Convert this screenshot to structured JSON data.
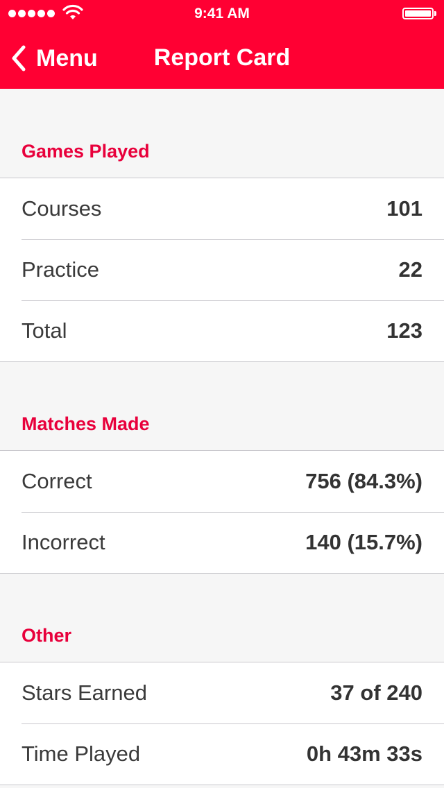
{
  "status_bar": {
    "time": "9:41 AM",
    "signal_bars": 5,
    "wifi_icon": "wifi-icon",
    "battery_icon": "battery-icon",
    "battery_level": 1.0
  },
  "nav": {
    "back_label": "Menu",
    "back_icon": "chevron-left-icon",
    "title": "Report Card"
  },
  "colors": {
    "accent": "#ff0033",
    "section_title": "#e8003b",
    "background": "#f6f6f6",
    "cell_background": "#ffffff",
    "separator": "#c8c7cc"
  },
  "sections": [
    {
      "title": "Games Played",
      "rows": [
        {
          "label": "Courses",
          "value": "101"
        },
        {
          "label": "Practice",
          "value": "22"
        },
        {
          "label": "Total",
          "value": "123"
        }
      ]
    },
    {
      "title": "Matches Made",
      "rows": [
        {
          "label": "Correct",
          "value": "756 (84.3%)"
        },
        {
          "label": "Incorrect",
          "value": "140 (15.7%)"
        }
      ]
    },
    {
      "title": "Other",
      "rows": [
        {
          "label": "Stars Earned",
          "value": "37 of 240"
        },
        {
          "label": "Time Played",
          "value": "0h 43m 33s"
        }
      ]
    }
  ]
}
